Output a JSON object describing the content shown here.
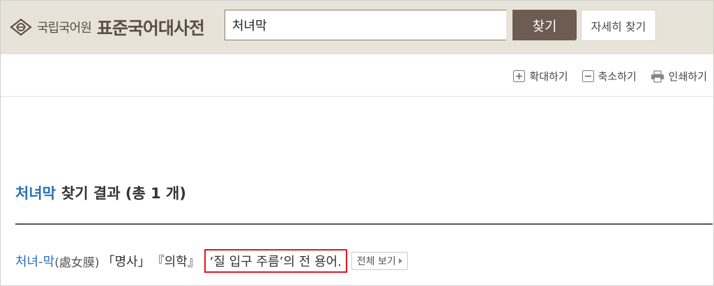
{
  "header": {
    "logo_institution": "국립국어원",
    "logo_dictionary": "표준국어대사전",
    "search_value": "처녀막",
    "search_button": "찾기",
    "detail_search_button": "자세히 찾기"
  },
  "toolbar": {
    "zoom_in": "확대하기",
    "zoom_out": "축소하기",
    "print": "인쇄하기"
  },
  "results": {
    "keyword": "처녀막",
    "title": "찾기 결과 (총 1 개)"
  },
  "entry": {
    "headword": "처녀-막",
    "hanja": "(處女膜)",
    "pos": "「명사」",
    "field": "『의학』",
    "definition": "‘질 입구 주름’의 전 용어.",
    "view_full": "전체 보기"
  },
  "colors": {
    "header_bg": "#e8e3d8",
    "brand_brown": "#6c5c52",
    "link_blue": "#2a6fb5",
    "highlight_red": "#e0161d"
  }
}
